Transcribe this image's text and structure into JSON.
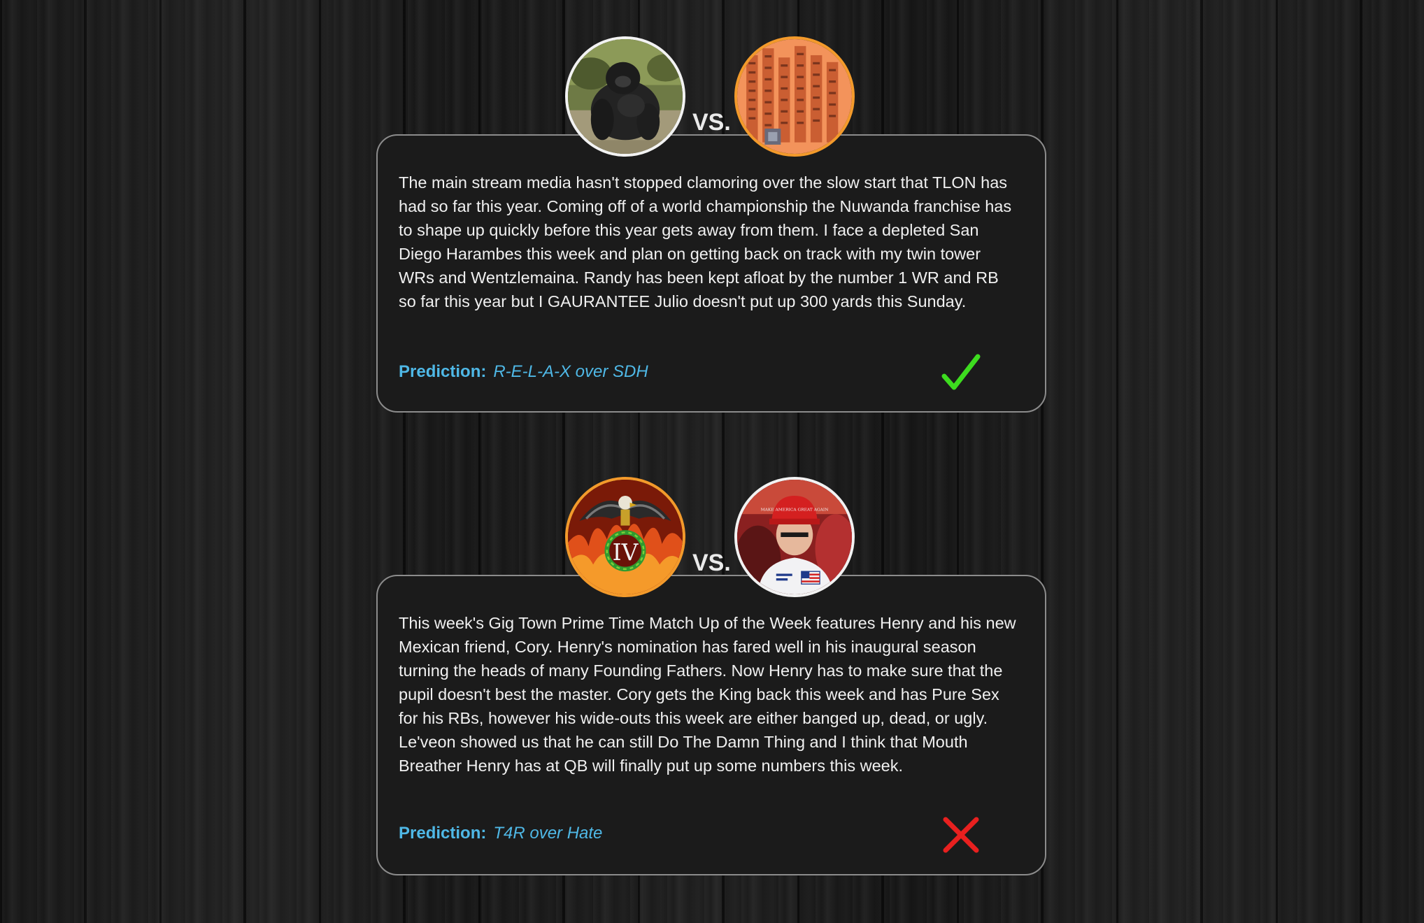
{
  "matchups": [
    {
      "vs_label": "VS.",
      "left_avatar": "gorilla-photo",
      "right_avatar": "orange-tower-collage",
      "text": "The main stream media hasn't stopped clamoring over the slow start that TLON has had so far this year. Coming off of a world championship the Nuwanda franchise has to shape up quickly before this year gets away from them. I face a depleted San Diego Harambes this week and plan on getting back on track with my twin tower WRs and Wentzlemaina. Randy has been kept afloat by the number 1 WR and RB so far this year but I GAURANTEE Julio doesn't put up 300 yards this Sunday.",
      "prediction_label": "Prediction:",
      "prediction_value": "R-E-L-A-X over SDH",
      "result": "correct",
      "result_icon": "checkmark-icon",
      "result_color": "#3ddc1f"
    },
    {
      "vs_label": "VS.",
      "left_avatar": "eagle-emblem-fire",
      "right_avatar": "football-player-red-cap",
      "left_avatar_text": "IV",
      "right_avatar_text": "MAKE AMERICA GREAT AGAIN",
      "text": "This week's Gig Town Prime Time Match Up of the Week features Henry and his new Mexican friend, Cory. Henry's nomination has fared well in his inaugural season turning the heads of many Founding Fathers. Now Henry has to make sure that the pupil doesn't best the master. Cory gets the King back this week and has Pure Sex for his RBs, however his wide-outs this week are either banged up, dead, or ugly. Le'veon showed us that he can still Do The Damn Thing and I think that Mouth Breather Henry has at QB will finally put up some numbers this week.",
      "prediction_label": "Prediction:",
      "prediction_value": "T4R over Hate",
      "result": "incorrect",
      "result_icon": "x-mark-icon",
      "result_color": "#e8201f"
    }
  ],
  "colors": {
    "accent": "#4fb8e6",
    "card_bg": "#1b1b1b",
    "card_border": "#8c8c8c",
    "avatar_ring_white": "#f2f2f2",
    "avatar_ring_orange": "#f39a2b"
  }
}
